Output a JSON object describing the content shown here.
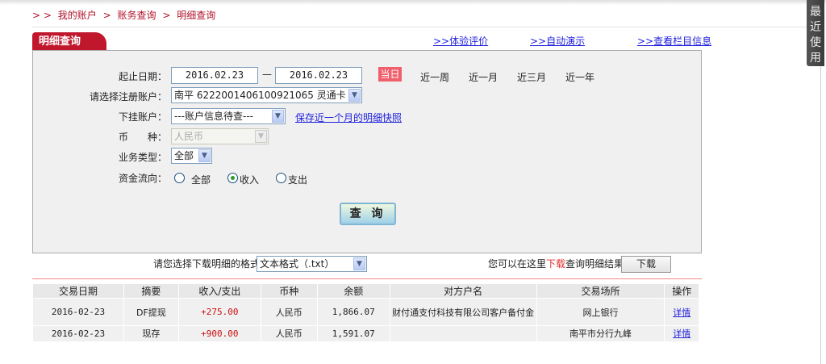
{
  "breadcrumb": {
    "prefix": "> >",
    "items": [
      "我的账户",
      "账务查询",
      "明细查询"
    ],
    "sep": ">"
  },
  "tab": {
    "title": "明细查询"
  },
  "top_links": [
    "体验评价",
    "自动演示",
    "查看栏目信息"
  ],
  "top_link_prefix": ">>",
  "side_tab": "最近使用",
  "form": {
    "date_label": "起止日期：",
    "start_date": "2016.02.23",
    "date_sep": "—",
    "end_date": "2016.02.23",
    "quick": [
      "当日",
      "近一周",
      "近一月",
      "近三月",
      "近一年"
    ],
    "account_label": "请选择注册账户：",
    "account_value": "南平  6222001406100921065 灵通卡",
    "sub_account_label": "下挂账户：",
    "sub_account_value": "---账户信息待查---",
    "snapshot_link": "保存近一个月的明细快照",
    "currency_label": "币　　种：",
    "currency_value": "人民币",
    "biz_type_label": "业务类型：",
    "biz_type_value": "全部",
    "flow_label": "资金流向：",
    "flow_options": [
      "全部",
      "收入",
      "支出"
    ],
    "flow_selected": "收入",
    "query_button": "查 询"
  },
  "download": {
    "format_label": "请您选择下载明细的格式",
    "format_value": "文本格式（.txt）",
    "hint_before": "您可以在这里",
    "hint_link": "下载",
    "hint_after": "查询明细结果",
    "button": "下载"
  },
  "table": {
    "headers": [
      "交易日期",
      "摘要",
      "收入/支出",
      "币种",
      "余额",
      "对方户名",
      "交易场所",
      "操作"
    ],
    "rows": [
      [
        "2016-02-23",
        "DF提现",
        "+275.00",
        "人民币",
        "1,866.07",
        "财付通支付科技有限公司客户备付金",
        "网上银行",
        "详情"
      ],
      [
        "2016-02-23",
        "现存",
        "+900.00",
        "人民币",
        "1,591.07",
        "",
        "南平市分行九峰",
        "详情"
      ]
    ]
  }
}
